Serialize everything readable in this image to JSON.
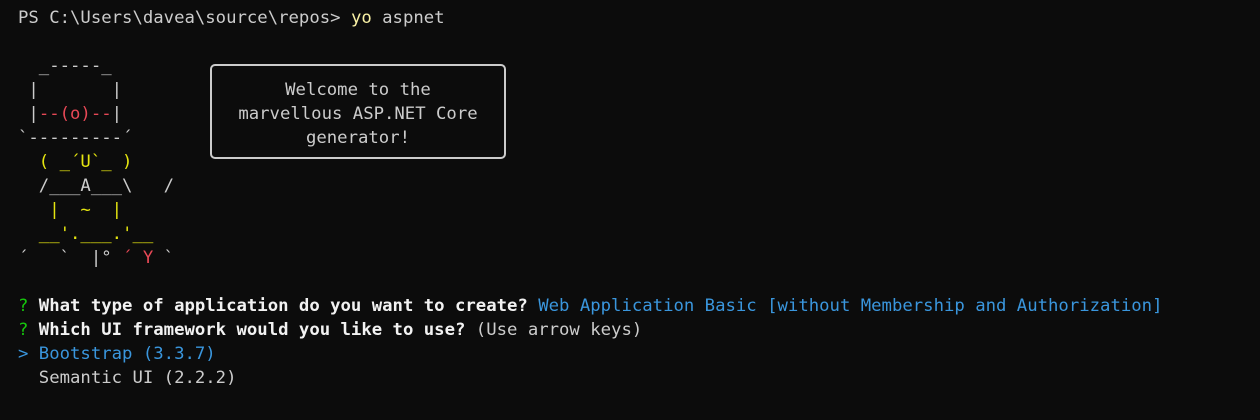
{
  "prompt": {
    "prefix": "PS C:\\Users\\davea\\source\\repos> ",
    "command": "yo",
    "argument": " aspnet"
  },
  "art": {
    "l1": "  _-----_",
    "l2a": " |       |",
    "l3_pipe1": " |",
    "l3_mid": "--(o)--",
    "l3_pipe2": "|",
    "l4": "`---------´",
    "l5": "  ( _´U`_ )",
    "l6a": "  /___A___\\",
    "l6b": "   /",
    "l7a": "   |  ~  |",
    "l8a": "  __'.___.'__",
    "l9a": "´   `  |° ",
    "l9b": "´ Y ",
    "l9c": "`"
  },
  "bubble": {
    "line1": "Welcome to the",
    "line2": "marvellous ASP.NET Core",
    "line3": "generator!"
  },
  "questions": {
    "q1_mark": "?",
    "q1_text": " What type of application do you want to create?",
    "q1_answer": " Web Application Basic [without Membership and Authorization]",
    "q2_mark": "?",
    "q2_text": " Which UI framework would you like to use?",
    "q2_hint": " (Use arrow keys)"
  },
  "options": {
    "pointer": ">",
    "selected": " Bootstrap (3.3.7)",
    "other": "  Semantic UI (2.2.2)"
  },
  "colors": {
    "background": "#0c0c0c",
    "foreground": "#cccccc",
    "command_yellow": "#f9f1a5",
    "accent_cyan": "#3a96dd",
    "red": "#e74856"
  }
}
